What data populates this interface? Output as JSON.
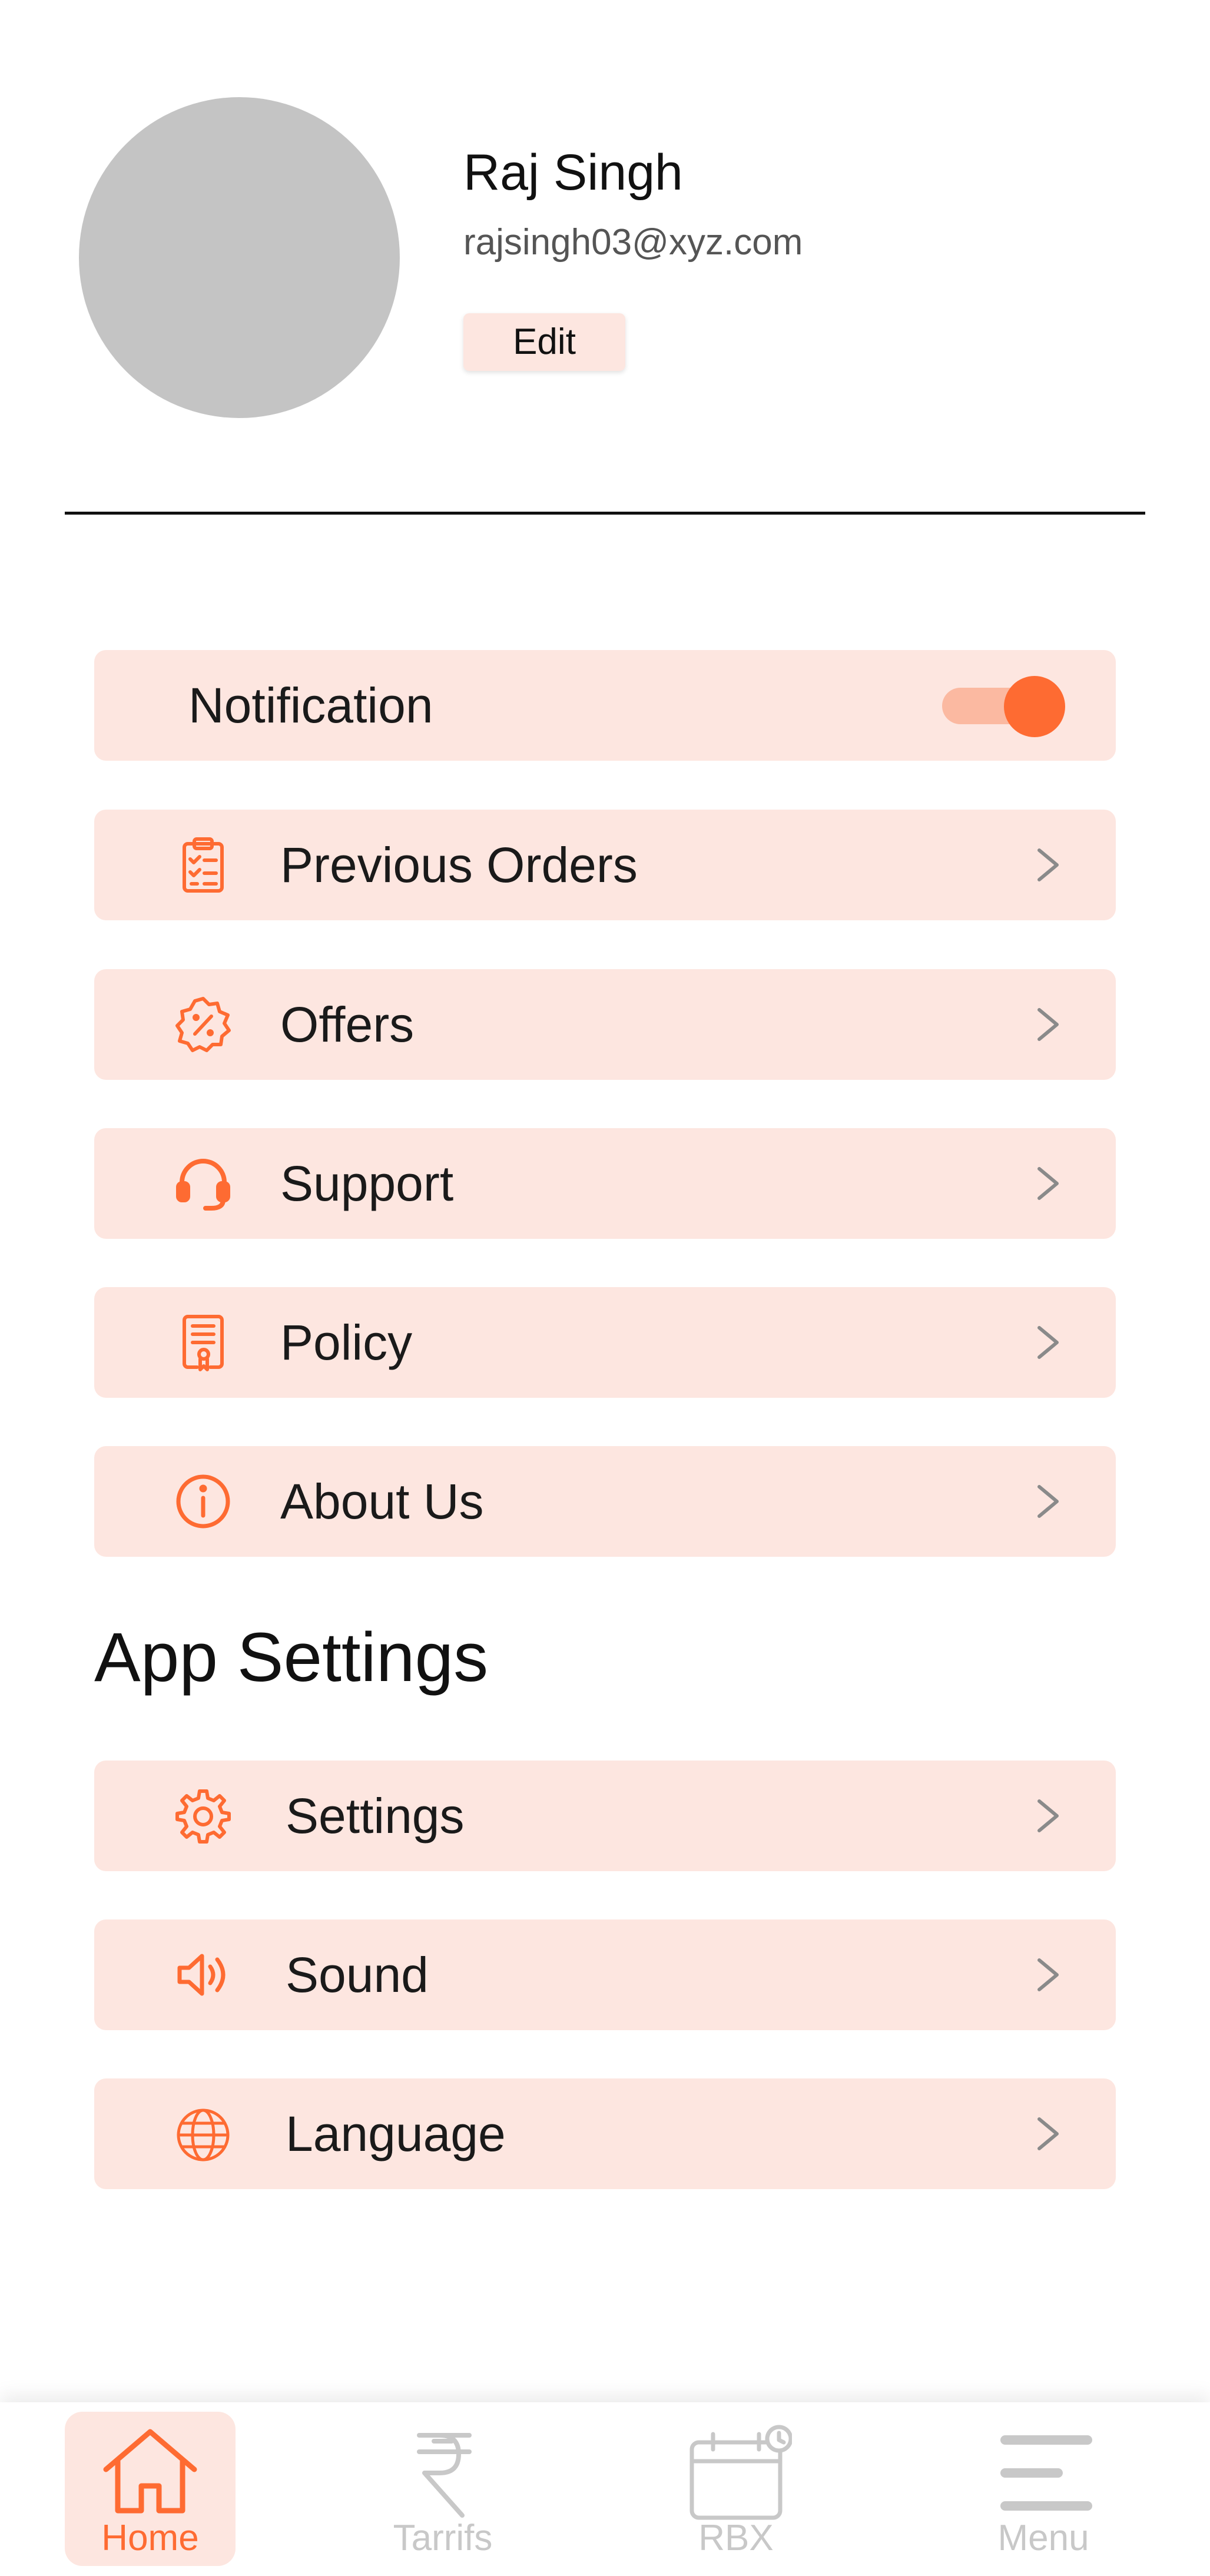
{
  "profile": {
    "name": "Raj Singh",
    "email": "rajsingh03@xyz.com",
    "edit_label": "Edit"
  },
  "notification": {
    "label": "Notification",
    "enabled": true
  },
  "menu": {
    "items": [
      {
        "label": "Previous Orders",
        "icon": "clipboard-checklist-icon"
      },
      {
        "label": "Offers",
        "icon": "discount-badge-icon"
      },
      {
        "label": "Support",
        "icon": "headset-icon"
      },
      {
        "label": "Policy",
        "icon": "certificate-document-icon"
      },
      {
        "label": "About Us",
        "icon": "info-icon"
      }
    ]
  },
  "app_settings": {
    "title": "App Settings",
    "items": [
      {
        "label": "Settings",
        "icon": "gear-icon"
      },
      {
        "label": "Sound",
        "icon": "speaker-icon"
      },
      {
        "label": "Language",
        "icon": "globe-icon"
      }
    ]
  },
  "bottom_nav": {
    "items": [
      {
        "label": "Home",
        "icon": "home-icon",
        "active": true
      },
      {
        "label": "Tarrifs",
        "icon": "rupee-icon",
        "active": false
      },
      {
        "label": "RBX",
        "icon": "calendar-clock-icon",
        "active": false
      },
      {
        "label": "Menu",
        "icon": "menu-icon",
        "active": false
      }
    ]
  },
  "colors": {
    "accent": "#fe6b32",
    "item_background": "#fde6e0",
    "toggle_track": "#fbb9a1",
    "avatar_placeholder": "#c4c4c4",
    "chevron": "#8a8a8a",
    "inactive_nav": "#c8c8c8"
  }
}
